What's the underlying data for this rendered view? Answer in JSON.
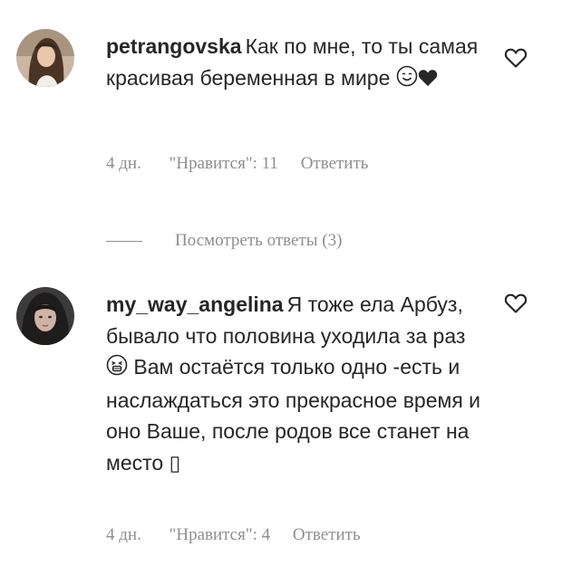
{
  "comments": [
    {
      "username": "petrangovska",
      "text_before_emoji": "Как по мне, то ты самая красивая беременная в мире",
      "emoji": [
        "smiling-face-emoji",
        "black-heart-emoji"
      ],
      "time": "4 дн.",
      "likes": "\"Нравится\": 11",
      "reply_label": "Ответить",
      "view_replies_label": "Посмотреть ответы (3)"
    },
    {
      "username": "my_way_angelina",
      "text_part1": "Я тоже ела Арбуз, бывало что половина уходила за раз",
      "text_part2": "Вам остаётся только одно -есть и наслаждаться это прекрасное время и оно Ваше, после родов все станет на место",
      "trailing_glyph": "▯",
      "time": "4 дн.",
      "likes": "\"Нравится\": 4",
      "reply_label": "Ответить"
    }
  ],
  "colors": {
    "text": "#262626",
    "secondary": "#8e8e8e",
    "background": "#ffffff"
  },
  "icons": {
    "like": "heart-outline-icon"
  }
}
